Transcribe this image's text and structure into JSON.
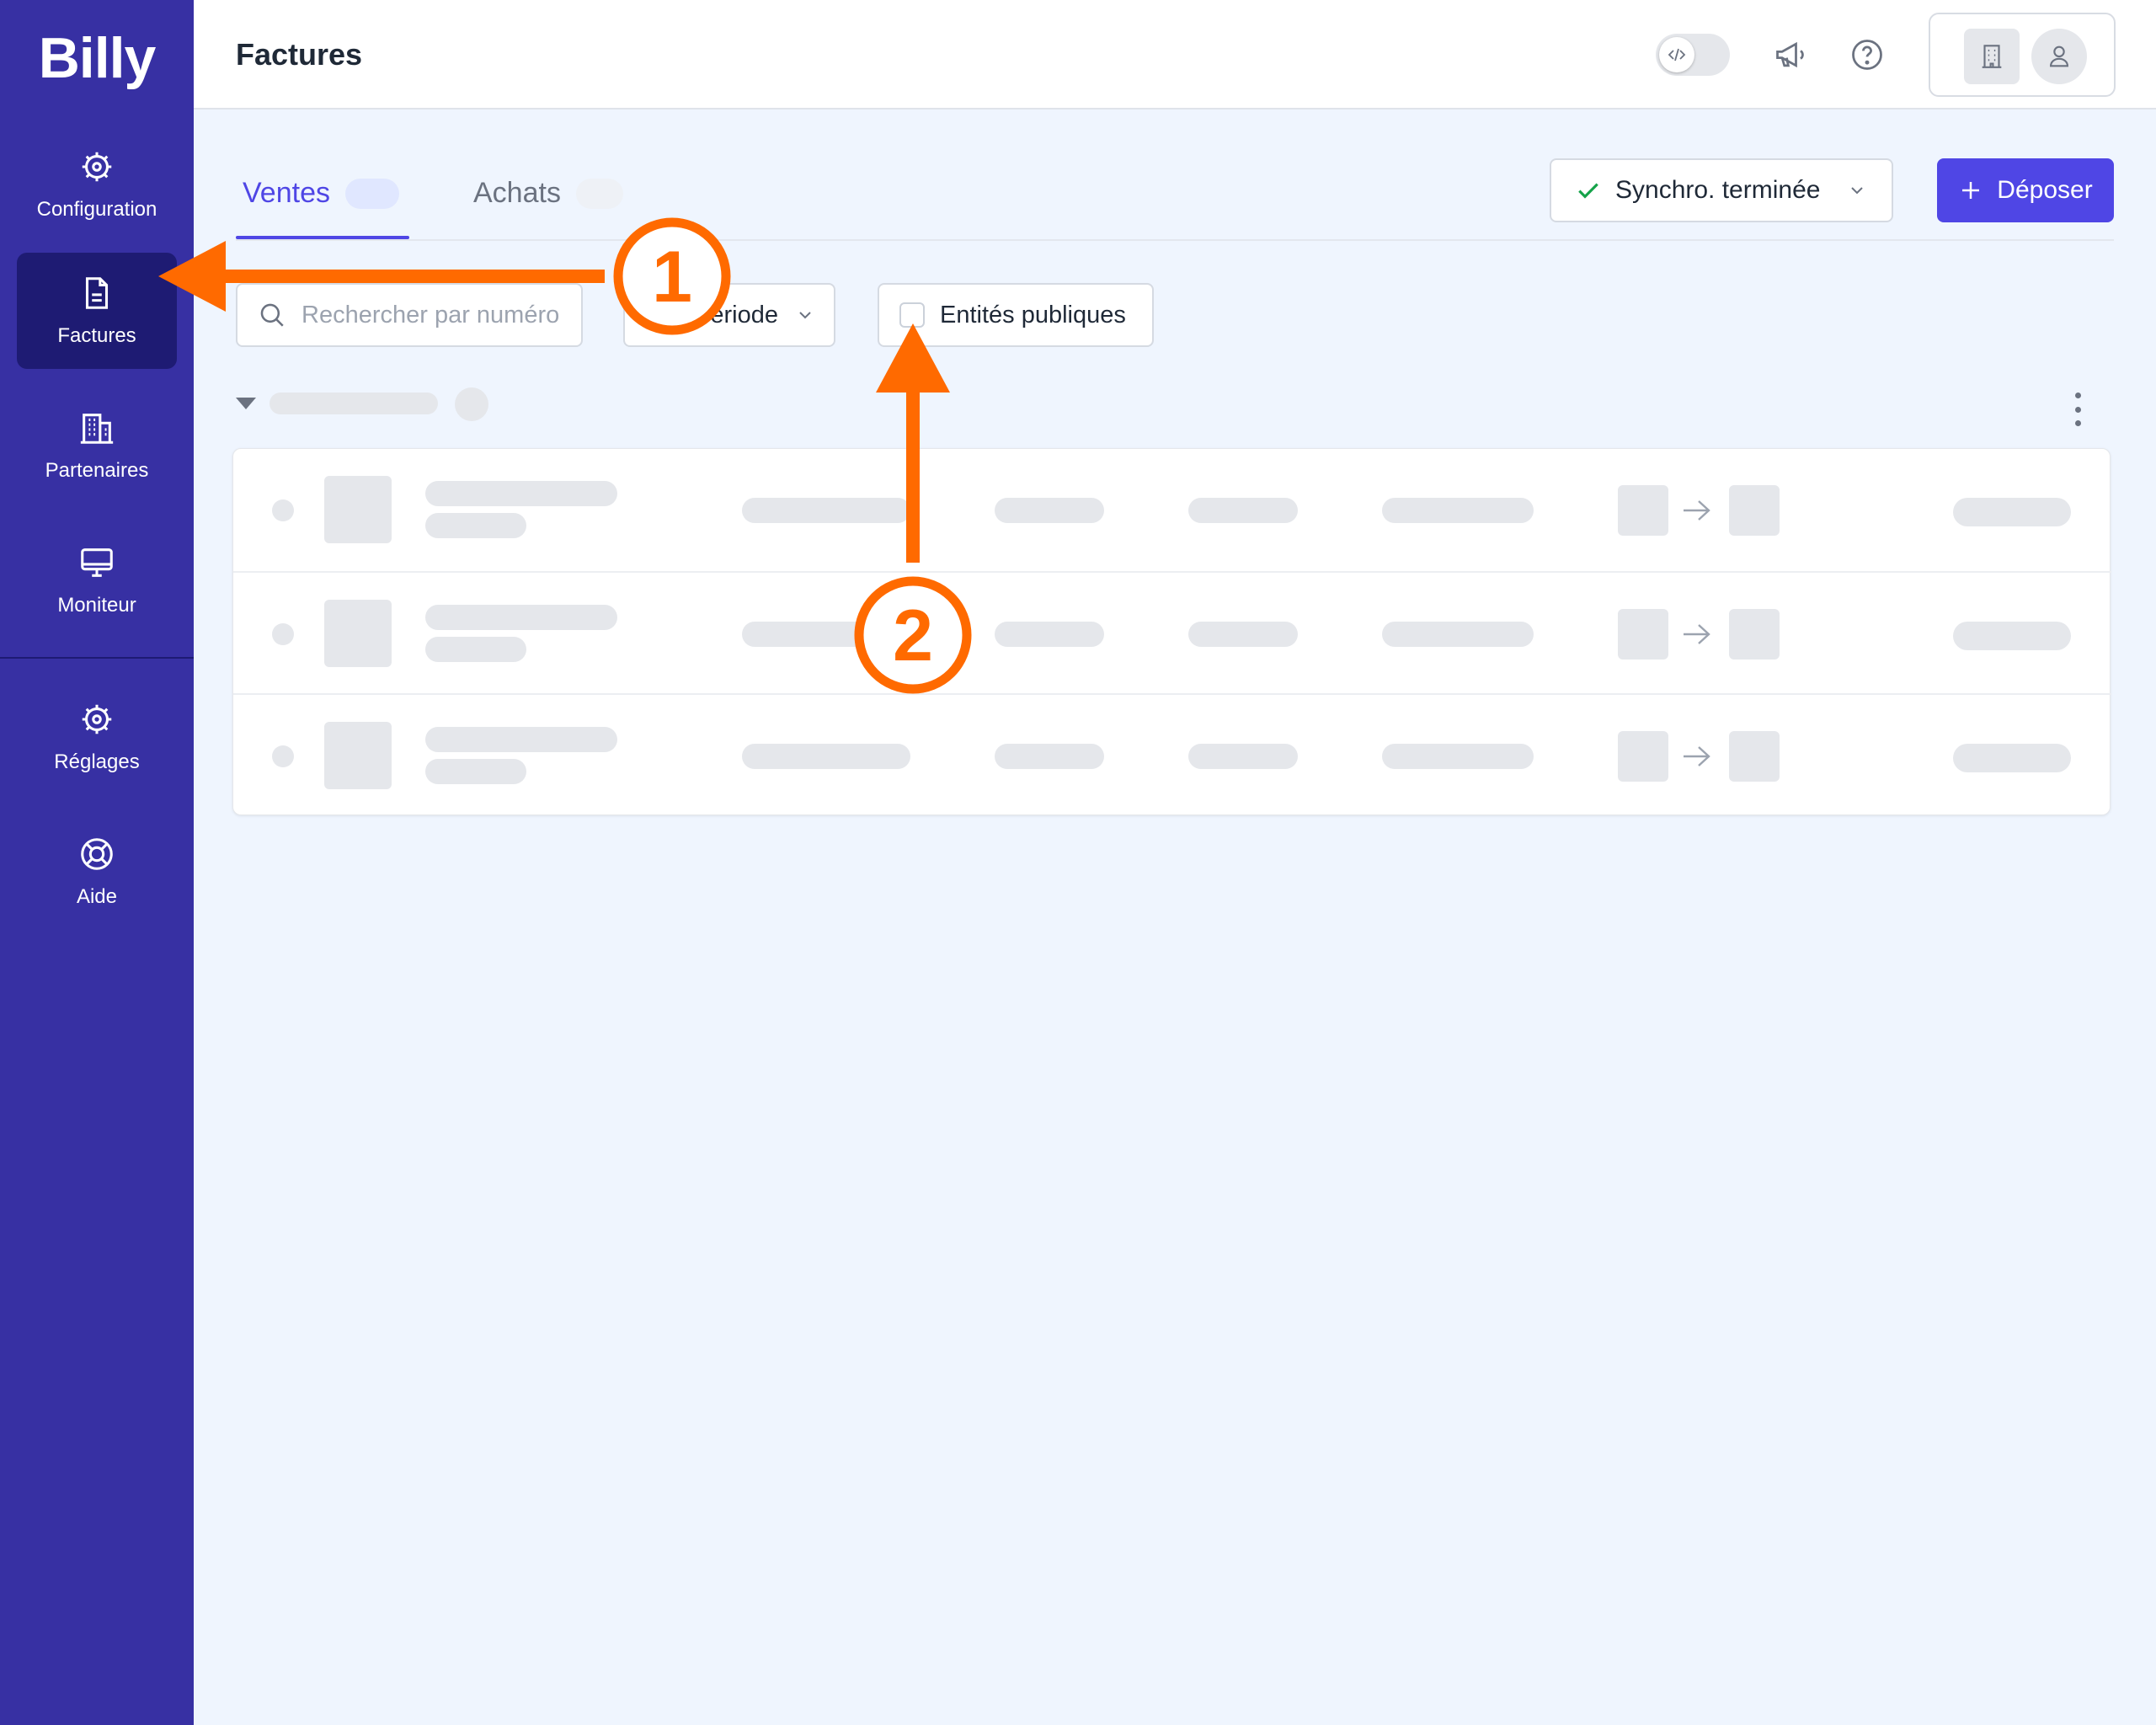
{
  "sidebar": {
    "logo": "Billy",
    "items": [
      {
        "label": "Configuration",
        "icon": "cog-icon"
      },
      {
        "label": "Factures",
        "icon": "document-icon"
      },
      {
        "label": "Partenaires",
        "icon": "building-icon"
      },
      {
        "label": "Moniteur",
        "icon": "monitor-icon"
      },
      {
        "label": "Réglages",
        "icon": "cog-icon"
      },
      {
        "label": "Aide",
        "icon": "lifebuoy-icon"
      }
    ],
    "active_item": "Factures",
    "colors": {
      "background": "#3730a3",
      "active": "#1e1b73"
    }
  },
  "header": {
    "title": "Factures",
    "icons": [
      "code-toggle-icon",
      "megaphone-icon",
      "help-icon",
      "building-icon",
      "user-icon"
    ]
  },
  "tabs": {
    "items": [
      {
        "label": "Ventes",
        "active": true
      },
      {
        "label": "Achats",
        "active": false
      }
    ],
    "accent": "#4f46e5"
  },
  "actions": {
    "sync_label": "Synchro. terminée",
    "deposit_label": "Déposer"
  },
  "filters": {
    "search_placeholder": "Rechercher par numéro",
    "period_label": "eriode",
    "public_entities_label": "Entités publiques",
    "public_entities_checked": false
  },
  "table": {
    "loading": true,
    "rows": 3
  },
  "annotations": {
    "markers": [
      "1",
      "2"
    ],
    "color": "#ff6a00"
  }
}
